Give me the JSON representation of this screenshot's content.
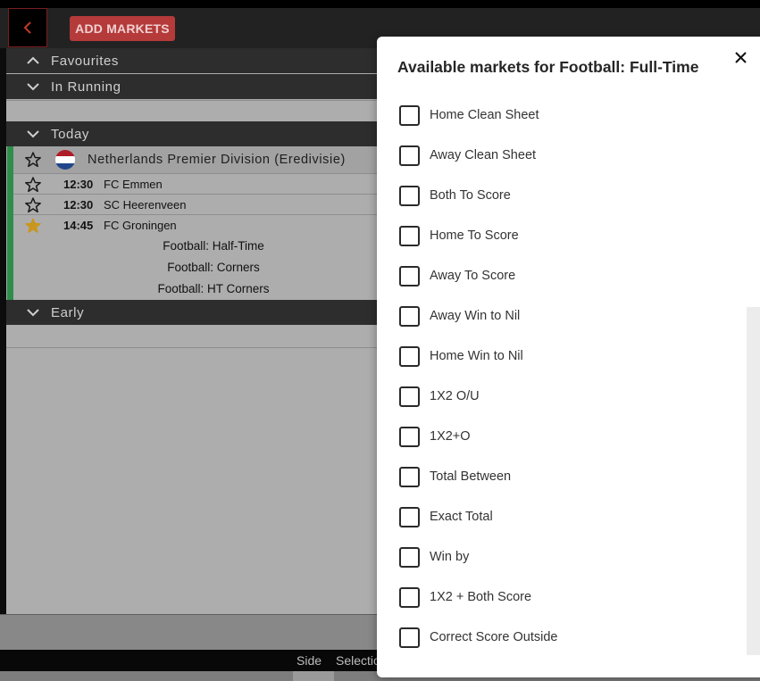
{
  "header": {
    "add_markets_label": "ADD MARKETS"
  },
  "sections": {
    "favourites": "Favourites",
    "in_running": "In Running",
    "today": "Today",
    "early": "Early"
  },
  "competition": {
    "name": "Netherlands Premier Division (Eredivisie)",
    "flag_colors": [
      "#ae1c28",
      "#ffffff",
      "#21468b"
    ]
  },
  "matches": [
    {
      "time": "12:30",
      "team": "FC Emmen",
      "favourite": false
    },
    {
      "time": "12:30",
      "team": "SC Heerenveen",
      "favourite": false
    },
    {
      "time": "14:45",
      "team": "FC Groningen",
      "favourite": true
    }
  ],
  "sub_markets": [
    "Football: Half-Time",
    "Football: Corners",
    "Football: HT Corners"
  ],
  "footer": {
    "side_label": "Side",
    "selection_label": "Selection"
  },
  "modal": {
    "title": "Available markets for Football: Full-Time",
    "options": [
      {
        "label": "Home Clean Sheet",
        "checked": false
      },
      {
        "label": "Away Clean Sheet",
        "checked": false
      },
      {
        "label": "Both To Score",
        "checked": false
      },
      {
        "label": "Home To Score",
        "checked": false
      },
      {
        "label": "Away To Score",
        "checked": false
      },
      {
        "label": "Away Win to Nil",
        "checked": false
      },
      {
        "label": "Home Win to Nil",
        "checked": false
      },
      {
        "label": "1X2 O/U",
        "checked": false
      },
      {
        "label": "1X2+O",
        "checked": false
      },
      {
        "label": "Total Between",
        "checked": false
      },
      {
        "label": "Exact Total",
        "checked": false
      },
      {
        "label": "Win by",
        "checked": false
      },
      {
        "label": "1X2 + Both Score",
        "checked": false
      },
      {
        "label": "Correct Score Outside",
        "checked": false
      }
    ]
  },
  "colors": {
    "accent_red": "#b53a3a",
    "favourite_star": "#c9961e",
    "in_play_green": "#2d8f4a"
  }
}
